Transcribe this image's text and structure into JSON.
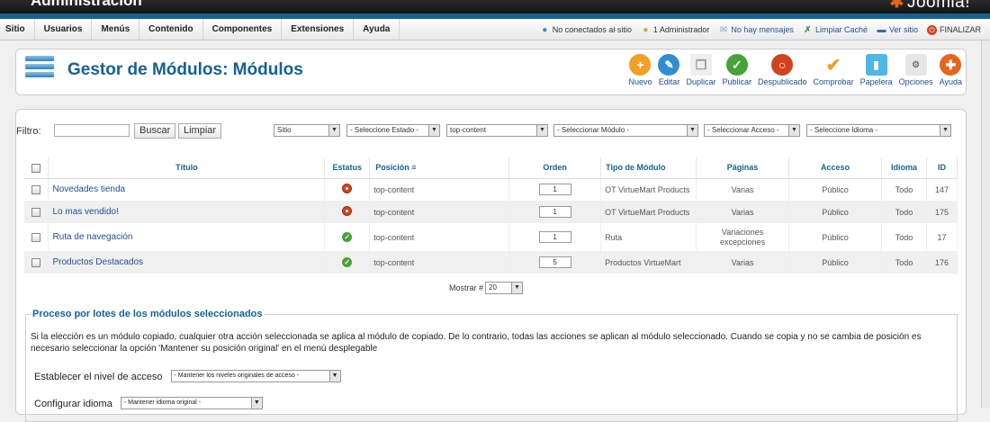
{
  "app": {
    "title": "Administración",
    "brand": "Joomla!"
  },
  "colors": {
    "brand_blue": "#146295",
    "link_blue": "#1f4f8f",
    "unpublished_red": "#d2421c",
    "published_green": "#46a335"
  },
  "menu": [
    "Sitio",
    "Usuarios",
    "Menús",
    "Contenido",
    "Componentes",
    "Extensiones",
    "Ayuda"
  ],
  "status": {
    "offline": "No conectados al sitio",
    "admins": "1 Administrador",
    "messages": "No hay mensajes",
    "cache": "Limpiar Caché",
    "view_site": "Ver sitio",
    "logout": "FINALIZAR"
  },
  "page_title": "Gestor de Módulos: Módulos",
  "toolbar": [
    {
      "label": "Nuevo",
      "icon": "plus-icon",
      "color": "#f2a024",
      "glyph": "+"
    },
    {
      "label": "Editar",
      "icon": "pencil-icon",
      "color": "#2e8ed1",
      "glyph": "✎"
    },
    {
      "label": "Duplicar",
      "icon": "copy-icon",
      "color": "#e6e6e6",
      "glyph": "❐"
    },
    {
      "label": "Publicar",
      "icon": "check-icon",
      "color": "#46a335",
      "glyph": "✓"
    },
    {
      "label": "Despublicado",
      "icon": "unpublish-icon",
      "color": "#d2421c",
      "glyph": "○"
    },
    {
      "label": "Comprobar",
      "icon": "checkmark-icon",
      "color": "#ffffff",
      "glyph": "✔"
    },
    {
      "label": "Papelera",
      "icon": "trash-icon",
      "color": "#4fb6e6",
      "glyph": "🗑"
    },
    {
      "label": "Opciones",
      "icon": "options-icon",
      "color": "#dddddd",
      "glyph": "⚙"
    },
    {
      "label": "Ayuda",
      "icon": "help-icon",
      "color": "#e8641b",
      "glyph": "✚"
    }
  ],
  "filters": {
    "label": "Filtro:",
    "search_value": "",
    "search_button": "Buscar",
    "clear_button": "Limpiar",
    "client": "Sitio",
    "state": "- Seleccione Estado -",
    "position": "top-content",
    "module": "- Seleccionar Módulo -",
    "access": "- Seleccionar Acceso -",
    "language": "- Seleccione Idioma -"
  },
  "table": {
    "columns": [
      "Título",
      "Estatus",
      "Posición",
      "Orden",
      "Tipo de Módulo",
      "Páginas",
      "Acceso",
      "Idioma",
      "ID"
    ],
    "rows": [
      {
        "title": "Novedades tienda",
        "status": "unpublished",
        "position": "top-content",
        "order": "1",
        "type": "OT VirtueMart Products",
        "pages": "Varias",
        "access": "Público",
        "language": "Todo",
        "id": "147"
      },
      {
        "title": "Lo mas vendido!",
        "status": "unpublished",
        "position": "top-content",
        "order": "1",
        "type": "OT VirtueMart Products",
        "pages": "Varias",
        "access": "Público",
        "language": "Todo",
        "id": "175"
      },
      {
        "title": "Ruta de navegación",
        "status": "published",
        "position": "top-content",
        "order": "1",
        "type": "Ruta",
        "pages": "Variaciones excepciones",
        "access": "Público",
        "language": "Todo",
        "id": "17"
      },
      {
        "title": "Productos Destacados",
        "status": "published",
        "position": "top-content",
        "order": "5",
        "type": "Productos VirtueMart",
        "pages": "Varias",
        "access": "Público",
        "language": "Todo",
        "id": "176"
      }
    ]
  },
  "pager": {
    "label": "Mostrar #",
    "value": "20"
  },
  "batch": {
    "legend": "Proceso por lotes de los módulos seleccionados",
    "text": "Si la elección es un módulo copiado, cualquier otra acción seleccionada se aplica al módulo de copiado. De lo contrario, todas las acciones se aplican al módulo seleccionado. Cuando se copia y no se cambia de posición es necesario seleccionar la opción 'Mantener su posición original' en el menú desplegable",
    "access_label": "Establecer el nivel de acceso",
    "access_value": "- Mantener los niveles originales de acceso -",
    "language_label": "Configurar idioma",
    "language_value": "- Mantener idioma original -"
  }
}
